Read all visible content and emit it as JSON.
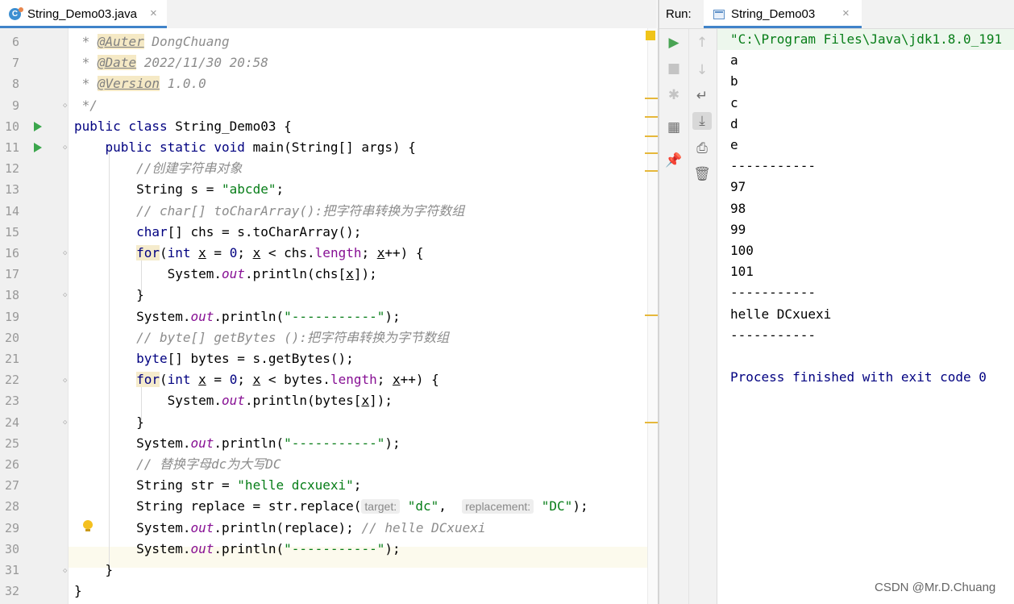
{
  "editor": {
    "tab": {
      "icon": "java-class-icon",
      "filename": "String_Demo03.java",
      "close": "×"
    },
    "lines": [
      {
        "n": "6",
        "seg": [
          {
            "t": " * ",
            "c": "cmt"
          },
          {
            "t": "@Auter",
            "c": "tag"
          },
          {
            "t": " DongChuang",
            "c": "cmt"
          }
        ]
      },
      {
        "n": "7",
        "seg": [
          {
            "t": " * ",
            "c": "cmt"
          },
          {
            "t": "@Date",
            "c": "tag"
          },
          {
            "t": " 2022/11/30 20:58",
            "c": "cmt"
          }
        ]
      },
      {
        "n": "8",
        "seg": [
          {
            "t": " * ",
            "c": "cmt"
          },
          {
            "t": "@Version",
            "c": "tag"
          },
          {
            "t": " 1.0.0",
            "c": "cmt"
          }
        ]
      },
      {
        "n": "9",
        "seg": [
          {
            "t": " */",
            "c": "cmt"
          }
        ]
      },
      {
        "n": "10",
        "seg": [
          {
            "t": "public class ",
            "c": "kw"
          },
          {
            "t": "String_Demo03 {",
            "c": ""
          }
        ]
      },
      {
        "n": "11",
        "seg": [
          {
            "t": "    "
          },
          {
            "t": "public static void ",
            "c": "kw"
          },
          {
            "t": "main(String[] args) {",
            "c": ""
          }
        ]
      },
      {
        "n": "12",
        "seg": [
          {
            "t": "        "
          },
          {
            "t": "//创建字符串对象",
            "c": "cmt"
          }
        ]
      },
      {
        "n": "13",
        "seg": [
          {
            "t": "        String s = "
          },
          {
            "t": "\"abcde\"",
            "c": "str"
          },
          {
            "t": ";"
          }
        ]
      },
      {
        "n": "14",
        "seg": [
          {
            "t": "        "
          },
          {
            "t": "// char[] toCharArray():把字符串转换为字符数组",
            "c": "cmt"
          }
        ]
      },
      {
        "n": "15",
        "seg": [
          {
            "t": "        "
          },
          {
            "t": "char",
            "c": "kw"
          },
          {
            "t": "[] chs = s.toCharArray();"
          }
        ]
      },
      {
        "n": "16",
        "seg": [
          {
            "t": "        "
          },
          {
            "t": "for",
            "c": "kw kwhl"
          },
          {
            "t": "("
          },
          {
            "t": "int ",
            "c": "kw"
          },
          {
            "t": "x",
            "c": "var"
          },
          {
            "t": " = "
          },
          {
            "t": "0",
            "c": "kw"
          },
          {
            "t": "; "
          },
          {
            "t": "x",
            "c": "var"
          },
          {
            "t": " < chs."
          },
          {
            "t": "length",
            "c": "fld"
          },
          {
            "t": "; "
          },
          {
            "t": "x",
            "c": "var"
          },
          {
            "t": "++) {"
          }
        ]
      },
      {
        "n": "17",
        "seg": [
          {
            "t": "            System."
          },
          {
            "t": "out",
            "c": "sfld"
          },
          {
            "t": ".println(chs["
          },
          {
            "t": "x",
            "c": "var"
          },
          {
            "t": "]);"
          }
        ]
      },
      {
        "n": "18",
        "seg": [
          {
            "t": "        }"
          }
        ]
      },
      {
        "n": "19",
        "seg": [
          {
            "t": "        System."
          },
          {
            "t": "out",
            "c": "sfld"
          },
          {
            "t": ".println("
          },
          {
            "t": "\"-----------\"",
            "c": "str"
          },
          {
            "t": ");"
          }
        ]
      },
      {
        "n": "20",
        "seg": [
          {
            "t": "        "
          },
          {
            "t": "// byte[] getBytes ():把字符串转换为字节数组",
            "c": "cmt"
          }
        ]
      },
      {
        "n": "21",
        "seg": [
          {
            "t": "        "
          },
          {
            "t": "byte",
            "c": "kw"
          },
          {
            "t": "[] bytes = s.getBytes();"
          }
        ]
      },
      {
        "n": "22",
        "seg": [
          {
            "t": "        "
          },
          {
            "t": "for",
            "c": "kw kwhl"
          },
          {
            "t": "("
          },
          {
            "t": "int ",
            "c": "kw"
          },
          {
            "t": "x",
            "c": "var"
          },
          {
            "t": " = "
          },
          {
            "t": "0",
            "c": "kw"
          },
          {
            "t": "; "
          },
          {
            "t": "x",
            "c": "var"
          },
          {
            "t": " < bytes."
          },
          {
            "t": "length",
            "c": "fld"
          },
          {
            "t": "; "
          },
          {
            "t": "x",
            "c": "var"
          },
          {
            "t": "++) {"
          }
        ]
      },
      {
        "n": "23",
        "seg": [
          {
            "t": "            System."
          },
          {
            "t": "out",
            "c": "sfld"
          },
          {
            "t": ".println(bytes["
          },
          {
            "t": "x",
            "c": "var"
          },
          {
            "t": "]);"
          }
        ]
      },
      {
        "n": "24",
        "seg": [
          {
            "t": "        }"
          }
        ]
      },
      {
        "n": "25",
        "seg": [
          {
            "t": "        System."
          },
          {
            "t": "out",
            "c": "sfld"
          },
          {
            "t": ".println("
          },
          {
            "t": "\"-----------\"",
            "c": "str"
          },
          {
            "t": ");"
          }
        ]
      },
      {
        "n": "26",
        "seg": [
          {
            "t": "        "
          },
          {
            "t": "// 替换字母dc为大写DC",
            "c": "cmt"
          }
        ]
      },
      {
        "n": "27",
        "seg": [
          {
            "t": "        String str = "
          },
          {
            "t": "\"helle dcxuexi\"",
            "c": "str"
          },
          {
            "t": ";"
          }
        ]
      },
      {
        "n": "28",
        "seg": [
          {
            "t": "        String replace = str.replace("
          },
          {
            "t": "target:",
            "c": "hint"
          },
          {
            "t": " "
          },
          {
            "t": "\"dc\"",
            "c": "str"
          },
          {
            "t": ",  "
          },
          {
            "t": "replacement:",
            "c": "hint"
          },
          {
            "t": " "
          },
          {
            "t": "\"DC\"",
            "c": "str"
          },
          {
            "t": ");"
          }
        ]
      },
      {
        "n": "29",
        "seg": [
          {
            "t": "        System."
          },
          {
            "t": "out",
            "c": "sfld"
          },
          {
            "t": ".println(replace); "
          },
          {
            "t": "// helle DCxuexi",
            "c": "cmt"
          }
        ]
      },
      {
        "n": "30",
        "seg": [
          {
            "t": "        System."
          },
          {
            "t": "out",
            "c": "sfld"
          },
          {
            "t": ".println("
          },
          {
            "t": "\"-----------\"",
            "c": "str"
          },
          {
            "t": ");"
          }
        ]
      },
      {
        "n": "31",
        "seg": [
          {
            "t": "    }"
          }
        ]
      },
      {
        "n": "32",
        "seg": [
          {
            "t": "}"
          }
        ]
      }
    ]
  },
  "run": {
    "label": "Run:",
    "tab": {
      "icon": "run-config-icon",
      "name": "String_Demo03",
      "close": "×"
    },
    "toolbar1": [
      {
        "name": "rerun-icon",
        "glyph": "▶",
        "style": "green"
      },
      {
        "name": "stop-icon",
        "glyph": "■",
        "style": "dim"
      },
      {
        "name": "debug-settings-icon",
        "glyph": "✱",
        "style": "dim"
      },
      {
        "name": "layout-icon",
        "glyph": "▦",
        "style": ""
      },
      {
        "name": "pin-icon",
        "glyph": "📌",
        "style": ""
      }
    ],
    "toolbar2": [
      {
        "name": "up-arrow-icon",
        "glyph": "↑",
        "style": "dim"
      },
      {
        "name": "down-arrow-icon",
        "glyph": "↓",
        "style": "dim"
      },
      {
        "name": "soft-wrap-icon",
        "glyph": "↵",
        "style": ""
      },
      {
        "name": "scroll-to-end-icon",
        "glyph": "⤓",
        "style": "active"
      },
      {
        "name": "print-icon",
        "glyph": "⎙",
        "style": ""
      },
      {
        "name": "trash-icon",
        "glyph": "🗑",
        "style": ""
      }
    ],
    "console": [
      {
        "t": "\"C:\\Program Files\\Java\\jdk1.8.0_191",
        "c": "cmd"
      },
      {
        "t": "a"
      },
      {
        "t": "b"
      },
      {
        "t": "c"
      },
      {
        "t": "d"
      },
      {
        "t": "e"
      },
      {
        "t": "-----------"
      },
      {
        "t": "97"
      },
      {
        "t": "98"
      },
      {
        "t": "99"
      },
      {
        "t": "100"
      },
      {
        "t": "101"
      },
      {
        "t": "-----------"
      },
      {
        "t": "helle DCxuexi"
      },
      {
        "t": "-----------"
      },
      {
        "t": ""
      },
      {
        "t": "Process finished with exit code 0",
        "c": "exit"
      }
    ]
  },
  "watermark": "CSDN @Mr.D.Chuang"
}
